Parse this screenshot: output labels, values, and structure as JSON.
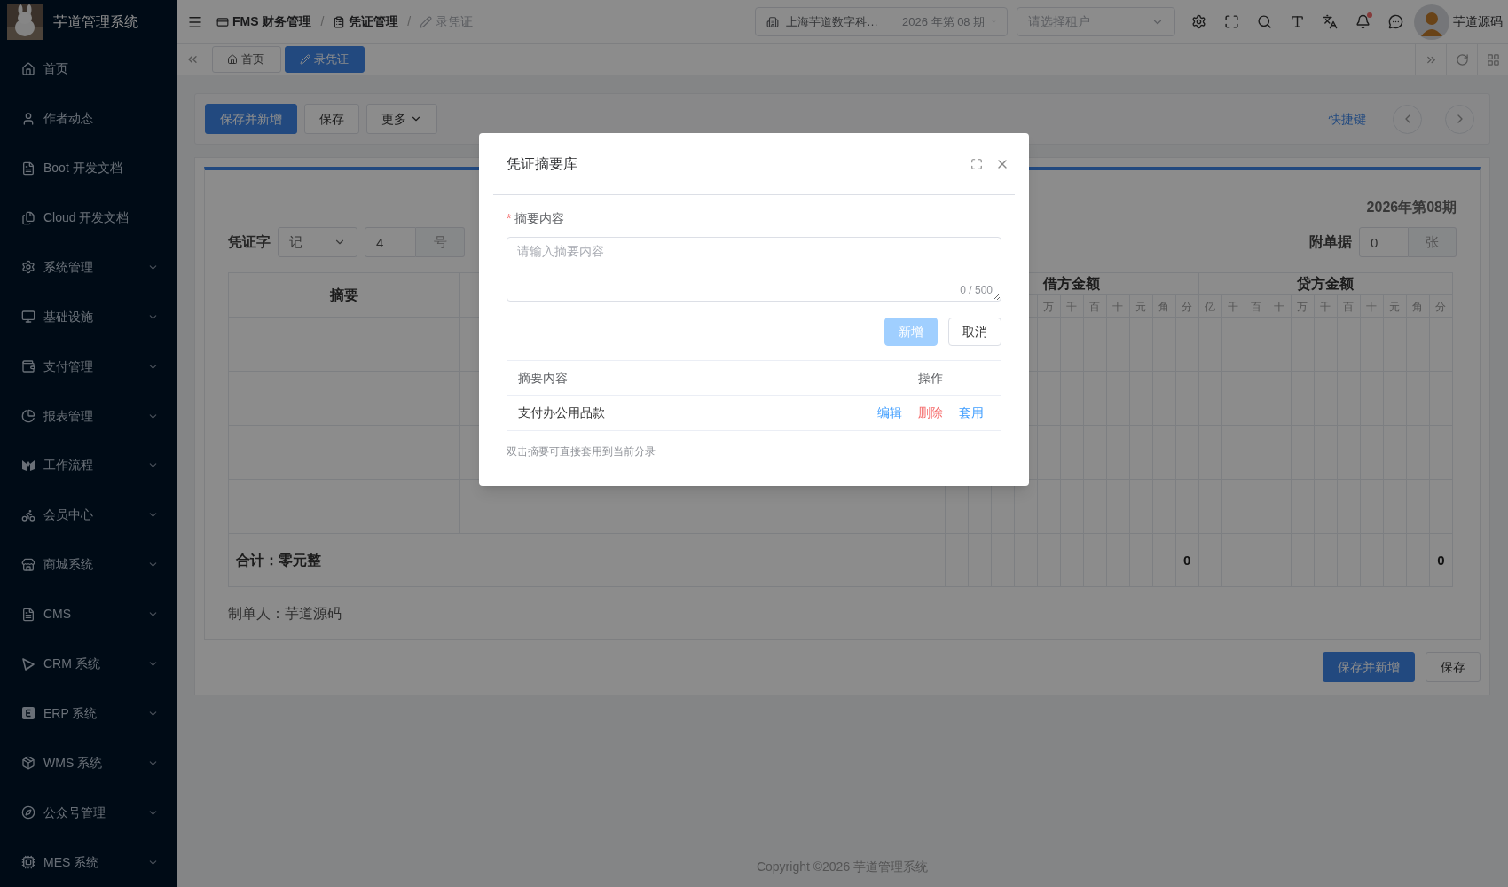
{
  "sidebar": {
    "brand": "芋道管理系统",
    "items": [
      {
        "label": "首页",
        "kind": "link"
      },
      {
        "label": "作者动态",
        "kind": "link"
      },
      {
        "label": "Boot 开发文档",
        "kind": "link"
      },
      {
        "label": "Cloud 开发文档",
        "kind": "link"
      },
      {
        "label": "系统管理",
        "kind": "group"
      },
      {
        "label": "基础设施",
        "kind": "group"
      },
      {
        "label": "支付管理",
        "kind": "group"
      },
      {
        "label": "报表管理",
        "kind": "group"
      },
      {
        "label": "工作流程",
        "kind": "group"
      },
      {
        "label": "会员中心",
        "kind": "group"
      },
      {
        "label": "商城系统",
        "kind": "group"
      },
      {
        "label": "CMS",
        "kind": "group"
      },
      {
        "label": "CRM 系统",
        "kind": "group"
      },
      {
        "label": "ERP 系统",
        "kind": "group"
      },
      {
        "label": "WMS 系统",
        "kind": "group"
      },
      {
        "label": "公众号管理",
        "kind": "group"
      },
      {
        "label": "MES 系统",
        "kind": "group"
      }
    ]
  },
  "header": {
    "breadcrumb": [
      {
        "label": "FMS 财务管理",
        "current": false
      },
      {
        "label": "凭证管理",
        "current": false
      },
      {
        "label": "录凭证",
        "current": true
      }
    ],
    "separator": "/",
    "company": "上海芋道数字科…",
    "period": "2026 年第 08 期",
    "tenant_placeholder": "请选择租户",
    "notification_dot": true,
    "user": "芋道源码"
  },
  "tabs": [
    {
      "label": "首页",
      "selected": false
    },
    {
      "label": "录凭证",
      "selected": true
    }
  ],
  "toolbar": {
    "buttons": [
      {
        "label": "保存并新增",
        "kind": "primary"
      },
      {
        "label": "保存",
        "kind": "default"
      },
      {
        "label": "更多",
        "kind": "dropdown"
      }
    ],
    "shortcut_link": "快捷键"
  },
  "voucher": {
    "period": "2026年第08期",
    "word_label": "凭证字",
    "word_value": "记",
    "number": "4",
    "number_suffix": "号",
    "attachments_label": "附单据",
    "attachments": "0",
    "attachments_suffix": "张",
    "columns": {
      "summary": "摘要",
      "debit": "借方金额",
      "credit": "贷方金额"
    },
    "debit_units": [
      "万",
      "千",
      "百",
      "十",
      "元",
      "角",
      "分"
    ],
    "credit_units": [
      "亿",
      "千",
      "百",
      "十",
      "万",
      "千",
      "百",
      "十",
      "元",
      "角",
      "分"
    ],
    "total_label": "合计：零元整",
    "debit_total": "0",
    "credit_total": "0",
    "maker": "制单人：芋道源码"
  },
  "bottom_buttons": [
    {
      "label": "保存并新增",
      "kind": "primary"
    },
    {
      "label": "保存",
      "kind": "default"
    }
  ],
  "footer": "Copyright ©2026 芋道管理系统",
  "dialog": {
    "title": "凭证摘要库",
    "field_label": "摘要内容",
    "required_mark": "*",
    "placeholder": "请输入摘要内容",
    "counter": "0 / 500",
    "buttons": [
      {
        "label": "新增",
        "kind": "primary",
        "disabled": true
      },
      {
        "label": "取消",
        "kind": "default",
        "disabled": false
      }
    ],
    "table": {
      "columns": [
        "摘要内容",
        "操作"
      ],
      "rows": [
        {
          "summary": "支付办公用品款",
          "actions": [
            {
              "label": "编辑",
              "color": "#409eff"
            },
            {
              "label": "删除",
              "color": "#f56c6c"
            },
            {
              "label": "套用",
              "color": "#409eff"
            }
          ]
        }
      ]
    },
    "hint": "双击摘要可直接套用到当前分录"
  }
}
